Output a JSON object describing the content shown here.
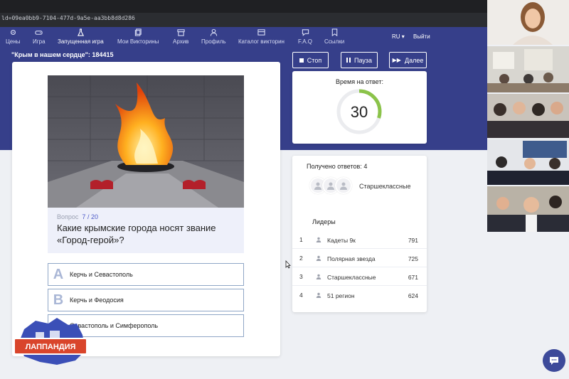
{
  "browser": {
    "url": "ld=09ea0bb9-7104-477d-9a5e-aa3bb8d8d286"
  },
  "nav": {
    "items": [
      {
        "label": "Цены",
        "icon": "settings-icon"
      },
      {
        "label": "Игра",
        "icon": "gamepad-icon"
      },
      {
        "label": "Запущенная игра",
        "icon": "flask-icon",
        "active": true
      },
      {
        "label": "Мои Викторины",
        "icon": "copy-icon"
      },
      {
        "label": "Архив",
        "icon": "archive-icon"
      },
      {
        "label": "Профиль",
        "icon": "user-icon"
      },
      {
        "label": "Каталог викторин",
        "icon": "catalog-icon"
      },
      {
        "label": "F.A.Q",
        "icon": "help-icon"
      },
      {
        "label": "Ссылки",
        "icon": "bookmark-icon"
      }
    ],
    "lang": "RU",
    "logout": "Выйти"
  },
  "quiz": {
    "title": "\"Крым в нашем сердце\": 184415"
  },
  "controls": {
    "stop": "Стоп",
    "pause": "Пауза",
    "next": "Далее"
  },
  "question": {
    "prefix": "Вопрос",
    "current": "7",
    "sep": "/",
    "total": "20",
    "text": "Какие крымские города носят звание «Город-герой»?",
    "options": [
      {
        "letter": "A",
        "text": "Керчь и Севастополь"
      },
      {
        "letter": "B",
        "text": "Керчь и Феодосия"
      },
      {
        "letter": "C",
        "text": "Севастополь и Симферополь"
      }
    ]
  },
  "timer": {
    "label": "Время на ответ:",
    "value": "30",
    "fraction": 0.3,
    "color": "#8bc34a"
  },
  "answers": {
    "received": "Получено ответов: 4",
    "team_tag": "Старшеклассные",
    "leaders_title": "Лидеры",
    "leaders": [
      {
        "rank": "1",
        "name": "Кадеты 9к",
        "score": "791"
      },
      {
        "rank": "2",
        "name": "Полярная звезда",
        "score": "725"
      },
      {
        "rank": "3",
        "name": "Старшеклассные",
        "score": "671"
      },
      {
        "rank": "4",
        "name": "51 регион",
        "score": "624"
      }
    ]
  },
  "logo": {
    "text": "ЛАППАНДИЯ"
  },
  "colors": {
    "brand": "#363f8a",
    "accent": "#4b59c7",
    "timer": "#8bc34a"
  }
}
